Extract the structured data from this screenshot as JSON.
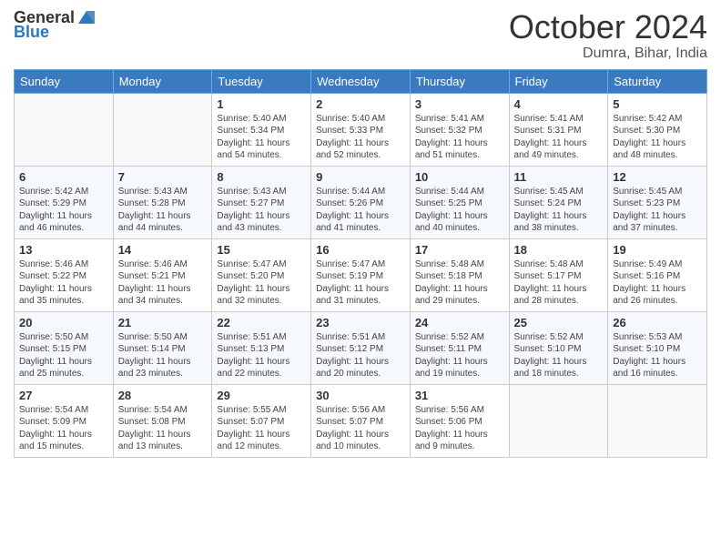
{
  "header": {
    "logo_general": "General",
    "logo_blue": "Blue",
    "month_title": "October 2024",
    "subtitle": "Dumra, Bihar, India"
  },
  "weekdays": [
    "Sunday",
    "Monday",
    "Tuesday",
    "Wednesday",
    "Thursday",
    "Friday",
    "Saturday"
  ],
  "weeks": [
    [
      {
        "day": "",
        "sunrise": "",
        "sunset": "",
        "daylight": ""
      },
      {
        "day": "",
        "sunrise": "",
        "sunset": "",
        "daylight": ""
      },
      {
        "day": "1",
        "sunrise": "Sunrise: 5:40 AM",
        "sunset": "Sunset: 5:34 PM",
        "daylight": "Daylight: 11 hours and 54 minutes."
      },
      {
        "day": "2",
        "sunrise": "Sunrise: 5:40 AM",
        "sunset": "Sunset: 5:33 PM",
        "daylight": "Daylight: 11 hours and 52 minutes."
      },
      {
        "day": "3",
        "sunrise": "Sunrise: 5:41 AM",
        "sunset": "Sunset: 5:32 PM",
        "daylight": "Daylight: 11 hours and 51 minutes."
      },
      {
        "day": "4",
        "sunrise": "Sunrise: 5:41 AM",
        "sunset": "Sunset: 5:31 PM",
        "daylight": "Daylight: 11 hours and 49 minutes."
      },
      {
        "day": "5",
        "sunrise": "Sunrise: 5:42 AM",
        "sunset": "Sunset: 5:30 PM",
        "daylight": "Daylight: 11 hours and 48 minutes."
      }
    ],
    [
      {
        "day": "6",
        "sunrise": "Sunrise: 5:42 AM",
        "sunset": "Sunset: 5:29 PM",
        "daylight": "Daylight: 11 hours and 46 minutes."
      },
      {
        "day": "7",
        "sunrise": "Sunrise: 5:43 AM",
        "sunset": "Sunset: 5:28 PM",
        "daylight": "Daylight: 11 hours and 44 minutes."
      },
      {
        "day": "8",
        "sunrise": "Sunrise: 5:43 AM",
        "sunset": "Sunset: 5:27 PM",
        "daylight": "Daylight: 11 hours and 43 minutes."
      },
      {
        "day": "9",
        "sunrise": "Sunrise: 5:44 AM",
        "sunset": "Sunset: 5:26 PM",
        "daylight": "Daylight: 11 hours and 41 minutes."
      },
      {
        "day": "10",
        "sunrise": "Sunrise: 5:44 AM",
        "sunset": "Sunset: 5:25 PM",
        "daylight": "Daylight: 11 hours and 40 minutes."
      },
      {
        "day": "11",
        "sunrise": "Sunrise: 5:45 AM",
        "sunset": "Sunset: 5:24 PM",
        "daylight": "Daylight: 11 hours and 38 minutes."
      },
      {
        "day": "12",
        "sunrise": "Sunrise: 5:45 AM",
        "sunset": "Sunset: 5:23 PM",
        "daylight": "Daylight: 11 hours and 37 minutes."
      }
    ],
    [
      {
        "day": "13",
        "sunrise": "Sunrise: 5:46 AM",
        "sunset": "Sunset: 5:22 PM",
        "daylight": "Daylight: 11 hours and 35 minutes."
      },
      {
        "day": "14",
        "sunrise": "Sunrise: 5:46 AM",
        "sunset": "Sunset: 5:21 PM",
        "daylight": "Daylight: 11 hours and 34 minutes."
      },
      {
        "day": "15",
        "sunrise": "Sunrise: 5:47 AM",
        "sunset": "Sunset: 5:20 PM",
        "daylight": "Daylight: 11 hours and 32 minutes."
      },
      {
        "day": "16",
        "sunrise": "Sunrise: 5:47 AM",
        "sunset": "Sunset: 5:19 PM",
        "daylight": "Daylight: 11 hours and 31 minutes."
      },
      {
        "day": "17",
        "sunrise": "Sunrise: 5:48 AM",
        "sunset": "Sunset: 5:18 PM",
        "daylight": "Daylight: 11 hours and 29 minutes."
      },
      {
        "day": "18",
        "sunrise": "Sunrise: 5:48 AM",
        "sunset": "Sunset: 5:17 PM",
        "daylight": "Daylight: 11 hours and 28 minutes."
      },
      {
        "day": "19",
        "sunrise": "Sunrise: 5:49 AM",
        "sunset": "Sunset: 5:16 PM",
        "daylight": "Daylight: 11 hours and 26 minutes."
      }
    ],
    [
      {
        "day": "20",
        "sunrise": "Sunrise: 5:50 AM",
        "sunset": "Sunset: 5:15 PM",
        "daylight": "Daylight: 11 hours and 25 minutes."
      },
      {
        "day": "21",
        "sunrise": "Sunrise: 5:50 AM",
        "sunset": "Sunset: 5:14 PM",
        "daylight": "Daylight: 11 hours and 23 minutes."
      },
      {
        "day": "22",
        "sunrise": "Sunrise: 5:51 AM",
        "sunset": "Sunset: 5:13 PM",
        "daylight": "Daylight: 11 hours and 22 minutes."
      },
      {
        "day": "23",
        "sunrise": "Sunrise: 5:51 AM",
        "sunset": "Sunset: 5:12 PM",
        "daylight": "Daylight: 11 hours and 20 minutes."
      },
      {
        "day": "24",
        "sunrise": "Sunrise: 5:52 AM",
        "sunset": "Sunset: 5:11 PM",
        "daylight": "Daylight: 11 hours and 19 minutes."
      },
      {
        "day": "25",
        "sunrise": "Sunrise: 5:52 AM",
        "sunset": "Sunset: 5:10 PM",
        "daylight": "Daylight: 11 hours and 18 minutes."
      },
      {
        "day": "26",
        "sunrise": "Sunrise: 5:53 AM",
        "sunset": "Sunset: 5:10 PM",
        "daylight": "Daylight: 11 hours and 16 minutes."
      }
    ],
    [
      {
        "day": "27",
        "sunrise": "Sunrise: 5:54 AM",
        "sunset": "Sunset: 5:09 PM",
        "daylight": "Daylight: 11 hours and 15 minutes."
      },
      {
        "day": "28",
        "sunrise": "Sunrise: 5:54 AM",
        "sunset": "Sunset: 5:08 PM",
        "daylight": "Daylight: 11 hours and 13 minutes."
      },
      {
        "day": "29",
        "sunrise": "Sunrise: 5:55 AM",
        "sunset": "Sunset: 5:07 PM",
        "daylight": "Daylight: 11 hours and 12 minutes."
      },
      {
        "day": "30",
        "sunrise": "Sunrise: 5:56 AM",
        "sunset": "Sunset: 5:07 PM",
        "daylight": "Daylight: 11 hours and 10 minutes."
      },
      {
        "day": "31",
        "sunrise": "Sunrise: 5:56 AM",
        "sunset": "Sunset: 5:06 PM",
        "daylight": "Daylight: 11 hours and 9 minutes."
      },
      {
        "day": "",
        "sunrise": "",
        "sunset": "",
        "daylight": ""
      },
      {
        "day": "",
        "sunrise": "",
        "sunset": "",
        "daylight": ""
      }
    ]
  ]
}
